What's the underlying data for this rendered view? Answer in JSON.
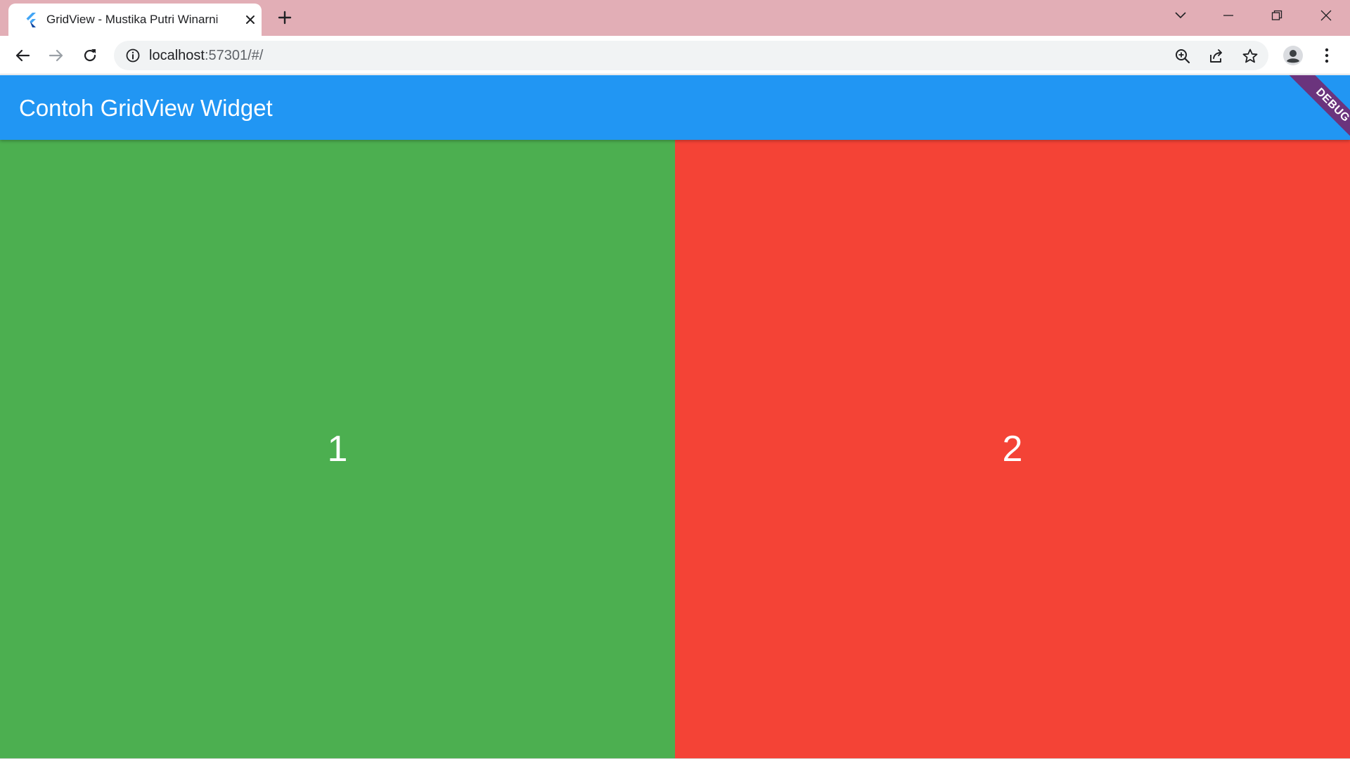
{
  "browser": {
    "tab": {
      "title": "GridView - Mustika Putri Winarni",
      "favicon": "flutter-icon"
    },
    "address_bar": {
      "host": "localhost",
      "path": ":57301/#/"
    }
  },
  "app": {
    "appbar_title": "Contoh GridView Widget",
    "debug_banner": "DEBUG",
    "grid": {
      "items": [
        {
          "label": "1",
          "color": "#4caf50"
        },
        {
          "label": "2",
          "color": "#f44336"
        }
      ]
    }
  },
  "colors": {
    "titlebar": "#e2aeb6",
    "appbar": "#2196f3",
    "debug_banner": "#880e4f"
  }
}
